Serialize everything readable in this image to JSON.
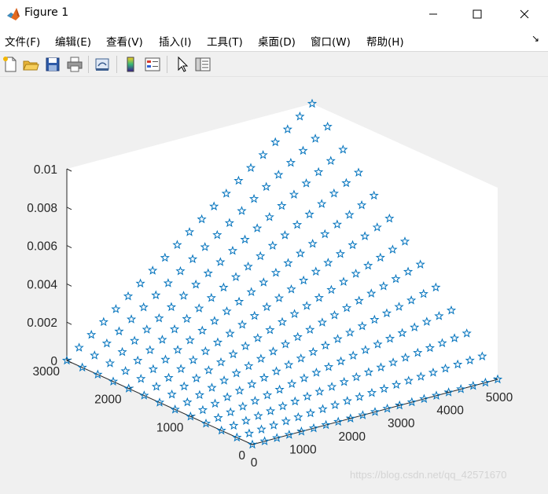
{
  "window": {
    "title": "Figure 1",
    "icon": "matlab-icon"
  },
  "menubar": {
    "items": [
      "文件(F)",
      "编辑(E)",
      "查看(V)",
      "插入(I)",
      "工具(T)",
      "桌面(D)",
      "窗口(W)",
      "帮助(H)"
    ],
    "dock_arrow": "↘"
  },
  "toolbar": {
    "icons": [
      "new-figure-icon",
      "open-file-icon",
      "save-icon",
      "print-icon",
      "link-plot-icon",
      "colorbar-icon",
      "legend-icon",
      "pointer-icon",
      "property-editor-icon"
    ]
  },
  "chart_data": {
    "type": "scatter",
    "marker": "pentagram",
    "marker_color": "#0072BD",
    "projection": "3d",
    "x": {
      "range": [
        0,
        5000
      ],
      "ticks": [
        0,
        1000,
        2000,
        3000,
        4000,
        5000
      ],
      "tick_labels": [
        "0",
        "1000",
        "2000",
        "3000",
        "4000",
        "5000"
      ]
    },
    "y": {
      "range": [
        0,
        3000
      ],
      "ticks": [
        0,
        1000,
        2000,
        3000
      ],
      "tick_labels": [
        "0",
        "1000",
        "2000",
        "3000"
      ]
    },
    "z": {
      "range": [
        0,
        0.01
      ],
      "ticks": [
        0,
        0.002,
        0.004,
        0.006,
        0.008,
        0.01
      ],
      "tick_labels": [
        "0",
        "0.002",
        "0.004",
        "0.006",
        "0.008",
        "0.01"
      ]
    },
    "grid": false,
    "series": [
      {
        "x_values": [
          0,
          250,
          500,
          750,
          1000,
          1250,
          1500,
          1750,
          2000,
          2250,
          2500,
          2750,
          3000,
          3250,
          3500,
          3750,
          4000,
          4250,
          4500,
          4750,
          5000
        ],
        "y_values": [
          0,
          250,
          500,
          750,
          1000,
          1250,
          1500,
          1750,
          2000,
          2250,
          2500,
          2750,
          3000
        ],
        "z_rule": "z = 0 for all points on the x = 0 edge and on the y = 0 edge; elsewhere z rises with both x and y, reaching 0.01 at x = 5000, y = 3000",
        "z_max": 0.01,
        "z_at_x0": 0,
        "z_at_y0": 0
      }
    ]
  },
  "watermark": "https://blog.csdn.net/qq_42571670"
}
